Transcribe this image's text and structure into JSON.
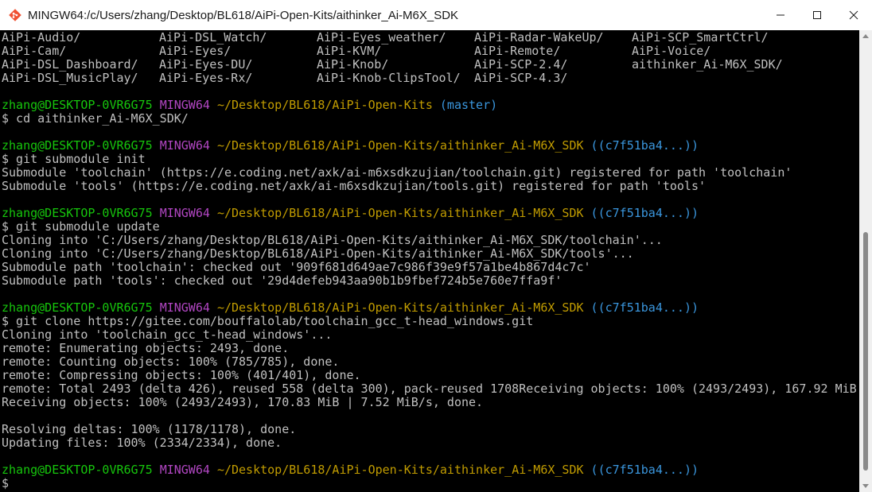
{
  "window": {
    "title": "MINGW64:/c/Users/zhang/Desktop/BL618/AiPi-Open-Kits/aithinker_Ai-M6X_SDK",
    "app_icon": "git-bash-icon",
    "controls": {
      "minimize_icon": "minimize-icon",
      "maximize_icon": "maximize-icon",
      "close_icon": "close-icon"
    }
  },
  "colors": {
    "background": "#000000",
    "text": "#c0c0c0",
    "user_host": "#16c60c",
    "mingw": "#b146c2",
    "path": "#c19c00",
    "branch": "#3a96dd"
  },
  "terminal": {
    "ls_rows": [
      [
        "AiPi-Audio/",
        "AiPi-DSL_Watch/",
        "AiPi-Eyes_weather/",
        "AiPi-Radar-WakeUp/",
        "AiPi-SCP_SmartCtrl/"
      ],
      [
        "AiPi-Cam/",
        "AiPi-Eyes/",
        "AiPi-KVM/",
        "AiPi-Remote/",
        "AiPi-Voice/"
      ],
      [
        "AiPi-DSL_Dashboard/",
        "AiPi-Eyes-DU/",
        "AiPi-Knob/",
        "AiPi-SCP-2.4/",
        "aithinker_Ai-M6X_SDK/"
      ],
      [
        "AiPi-DSL_MusicPlay/",
        "AiPi-Eyes-Rx/",
        "AiPi-Knob-ClipsTool/",
        "AiPi-SCP-4.3/",
        ""
      ]
    ],
    "prompts": [
      {
        "user": "zhang@DESKTOP-0VR6G75",
        "env": "MINGW64",
        "path": "~/Desktop/BL618/AiPi-Open-Kits",
        "branch": "(master)"
      },
      {
        "user": "zhang@DESKTOP-0VR6G75",
        "env": "MINGW64",
        "path": "~/Desktop/BL618/AiPi-Open-Kits/aithinker_Ai-M6X_SDK",
        "branch": "((c7f51ba4...))"
      },
      {
        "user": "zhang@DESKTOP-0VR6G75",
        "env": "MINGW64",
        "path": "~/Desktop/BL618/AiPi-Open-Kits/aithinker_Ai-M6X_SDK",
        "branch": "((c7f51ba4...))"
      },
      {
        "user": "zhang@DESKTOP-0VR6G75",
        "env": "MINGW64",
        "path": "~/Desktop/BL618/AiPi-Open-Kits/aithinker_Ai-M6X_SDK",
        "branch": "((c7f51ba4...))"
      },
      {
        "user": "zhang@DESKTOP-0VR6G75",
        "env": "MINGW64",
        "path": "~/Desktop/BL618/AiPi-Open-Kits/aithinker_Ai-M6X_SDK",
        "branch": "((c7f51ba4...))"
      }
    ],
    "commands": [
      "$ cd aithinker_Ai-M6X_SDK/",
      "$ git submodule init",
      "$ git submodule update",
      "$ git clone https://gitee.com/bouffalolab/toolchain_gcc_t-head_windows.git",
      "$"
    ],
    "outputs": [
      [],
      [
        "Submodule 'toolchain' (https://e.coding.net/axk/ai-m6xsdkzujian/toolchain.git) registered for path 'toolchain'",
        "Submodule 'tools' (https://e.coding.net/axk/ai-m6xsdkzujian/tools.git) registered for path 'tools'"
      ],
      [
        "Cloning into 'C:/Users/zhang/Desktop/BL618/AiPi-Open-Kits/aithinker_Ai-M6X_SDK/toolchain'...",
        "Cloning into 'C:/Users/zhang/Desktop/BL618/AiPi-Open-Kits/aithinker_Ai-M6X_SDK/tools'...",
        "Submodule path 'toolchain': checked out '909f681d649ae7c986f39e9f57a1be4b867d4c7c'",
        "Submodule path 'tools': checked out '29d4defeb943aa90b1b9fbef724b5e760e7ffa9f'"
      ],
      [
        "Cloning into 'toolchain_gcc_t-head_windows'...",
        "remote: Enumerating objects: 2493, done.",
        "remote: Counting objects: 100% (785/785), done.",
        "remote: Compressing objects: 100% (401/401), done.",
        "remote: Total 2493 (delta 426), reused 558 (delta 300), pack-reused 1708Receiving objects: 100% (2493/2493), 167.92 MiB",
        "Receiving objects: 100% (2493/2493), 170.83 MiB | 7.52 MiB/s, done.",
        "",
        "Resolving deltas: 100% (1178/1178), done.",
        "Updating files: 100% (2334/2334), done."
      ],
      []
    ]
  }
}
